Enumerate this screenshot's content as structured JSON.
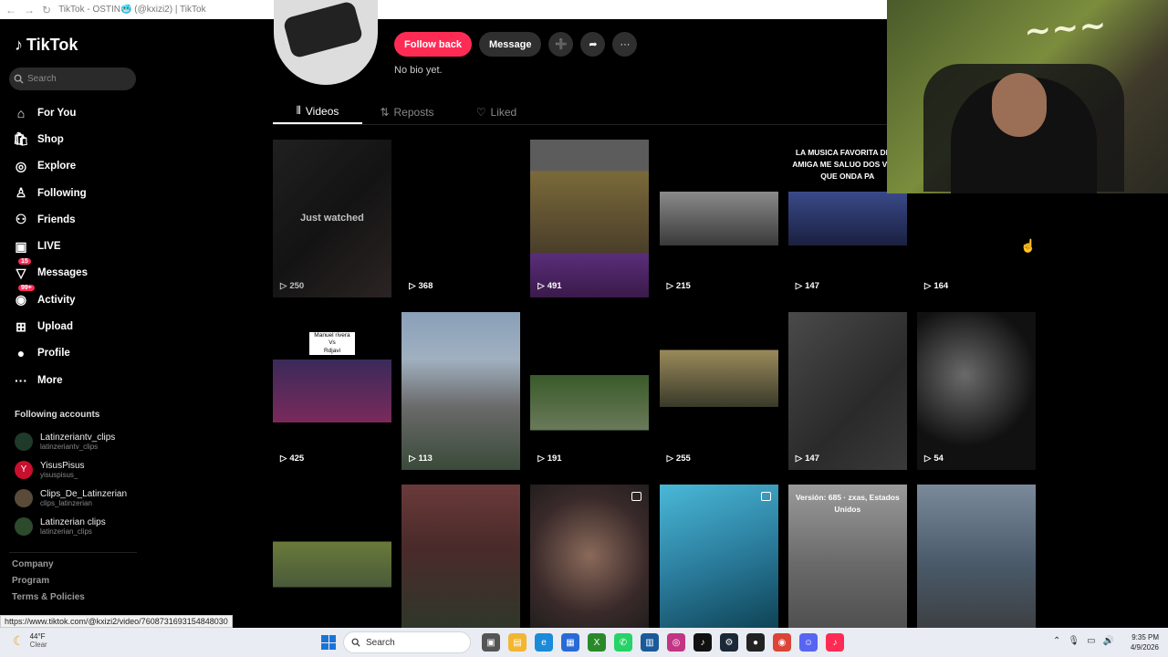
{
  "browser": {
    "title": "TikTok - OSTIN🥶 (@kxizi2) | TikTok",
    "back_glyph": "←",
    "fwd_glyph": "→",
    "reload_glyph": "↻"
  },
  "sidebar": {
    "logo": "TikTok",
    "search_placeholder": "Search",
    "nav": [
      {
        "label": "For You",
        "icon": "home-icon",
        "glyph": "⌂"
      },
      {
        "label": "Shop",
        "icon": "shop-icon",
        "glyph": "🛍"
      },
      {
        "label": "Explore",
        "icon": "compass-icon",
        "glyph": "◎"
      },
      {
        "label": "Following",
        "icon": "following-icon",
        "glyph": "♙"
      },
      {
        "label": "Friends",
        "icon": "friends-icon",
        "glyph": "⚇"
      },
      {
        "label": "LIVE",
        "icon": "live-icon",
        "glyph": "▣"
      },
      {
        "label": "Messages",
        "icon": "messages-icon",
        "glyph": "▽",
        "badge": "15"
      },
      {
        "label": "Activity",
        "icon": "activity-icon",
        "glyph": "◉",
        "badge": "99+"
      },
      {
        "label": "Upload",
        "icon": "upload-icon",
        "glyph": "⊞"
      },
      {
        "label": "Profile",
        "icon": "profile-icon",
        "glyph": "●"
      },
      {
        "label": "More",
        "icon": "more-icon",
        "glyph": "···"
      }
    ],
    "following_title": "Following accounts",
    "accounts": [
      {
        "name": "Latinzeriantv_clips",
        "handle": "latinzeriantv_clips",
        "avatar_bg": "#1f3a2a",
        "initial": ""
      },
      {
        "name": "YisusPisus",
        "handle": "yisuspisus_",
        "avatar_bg": "#c8102e",
        "initial": "Y"
      },
      {
        "name": "Clips_De_Latinzerian",
        "handle": "clips_latinzerian",
        "avatar_bg": "#5a4a3a",
        "initial": ""
      },
      {
        "name": "Latinzerian clips",
        "handle": "latinzerian_clips",
        "avatar_bg": "#2d4a2d",
        "initial": ""
      }
    ],
    "footer": [
      "Company",
      "Program",
      "Terms & Policies"
    ]
  },
  "profile": {
    "buttons": {
      "follow_back": "Follow back",
      "message": "Message",
      "add_friend_glyph": "➕",
      "share_glyph": "➦",
      "more_glyph": "···"
    },
    "bio": "No bio yet."
  },
  "tabs": [
    {
      "label": "Videos",
      "glyph": "⦀"
    },
    {
      "label": "Reposts",
      "glyph": "⇅"
    },
    {
      "label": "Liked",
      "glyph": "♡"
    }
  ],
  "videos": [
    {
      "views": "250",
      "bg": "linear-gradient(135deg,#2b2b2b,#1a1a1a 50%,#3a3030)",
      "just_watched": "Just watched",
      "faded": true
    },
    {
      "views": "368",
      "bg": "#000"
    },
    {
      "views": "491",
      "bg": "linear-gradient(180deg,#5c5c5c 0%,#5c5c5c 20%,#7a6a3a 20%,#4a3e2a 72%,#5a2e7a 72%,#3a1a4a 100%)"
    },
    {
      "views": "215",
      "bg": "linear-gradient(180deg,#000 0%,#000 33%,#8a8a8a 33%,#3a3a3a 67%,#000 67%)"
    },
    {
      "views": "147",
      "bg": "linear-gradient(180deg,#000 0%,#000 33%,#3a4a8a 33%,#1a2040 67%,#000 67%)",
      "overlay": "LA MUSICA FAVORITA DE M\nAMIGA ME SALUO DOS VESE\nQUE ONDA PA"
    },
    {
      "views": "164",
      "bg": "#000"
    },
    {
      "views": "425",
      "bg": "linear-gradient(180deg,#000 0%,#000 30%,#3a2a5a 30%,#7a2a5a 70%,#000 70%)",
      "label": "Manuel rivera\nVs\nRdjavi"
    },
    {
      "views": "113",
      "bg": "linear-gradient(180deg,#8aa0b8 0%,#a0b0c0 30%,#6a6a6a 60%,#3a4a3a 100%)"
    },
    {
      "views": "191",
      "bg": "linear-gradient(180deg,#000 0%,#000 40%,#3a5a2a 40%,#6a7a5a 75%,#000 75%)"
    },
    {
      "views": "255",
      "bg": "linear-gradient(180deg,#000 0%,#000 24%,#9a8a5a 24%,#3a3a2a 60%,#000 60%)"
    },
    {
      "views": "147",
      "bg": "linear-gradient(135deg,#4a4a4a,#2a2a2a 60%,#3a3a3a)"
    },
    {
      "views": "54",
      "bg": "radial-gradient(circle at 40% 40%,#6a6a6a,#111 60%)"
    },
    {
      "views": "",
      "bg": "linear-gradient(180deg,#000 0%,#000 36%,#6a7a3a 36%,#4a5a3a 65%,#000 65%)"
    },
    {
      "views": "",
      "bg": "linear-gradient(180deg,#6a3a3a,#4a2a2a 40%,#2a3a2a 100%)"
    },
    {
      "views": "",
      "bg": "radial-gradient(circle at 50% 45%,#8a6a5a,#3a2a2a 55%,#1a1a1a)",
      "gallery": true
    },
    {
      "views": "",
      "bg": "linear-gradient(160deg,#4ab8d8,#2a7a9a 50%,#0a3a4a)",
      "gallery": true
    },
    {
      "views": "",
      "bg": "linear-gradient(180deg,#9a9a9a,#6a6a6a 50%,#4a4a4a)",
      "overlay": "Versión: 685 · zxas, Estados Unidos"
    },
    {
      "views": "",
      "bg": "linear-gradient(180deg,#7a8a9a,#4a5a6a 50%,#3a3a3a)"
    }
  ],
  "status_url": "https://www.tiktok.com/@kxizi2/video/7608731693154848030",
  "taskbar": {
    "temp": "44°F",
    "weather": "Clear",
    "search": "Search",
    "time": "9:35 PM",
    "date": "4/9/2026",
    "apps": [
      {
        "name": "task-view-icon",
        "color": "#555",
        "glyph": "▣"
      },
      {
        "name": "file-explorer-icon",
        "color": "#f2b630",
        "glyph": "▤"
      },
      {
        "name": "edge-icon",
        "color": "#1b8ad8",
        "glyph": "e"
      },
      {
        "name": "store-icon",
        "color": "#2a6ad8",
        "glyph": "▦"
      },
      {
        "name": "xbox-icon",
        "color": "#2a8a2a",
        "glyph": "X"
      },
      {
        "name": "whatsapp-icon",
        "color": "#25d366",
        "glyph": "✆"
      },
      {
        "name": "photos-icon",
        "color": "#1a5a9a",
        "glyph": "▥"
      },
      {
        "name": "instagram-icon",
        "color": "#c13584",
        "glyph": "◎"
      },
      {
        "name": "tiktok-icon",
        "color": "#111",
        "glyph": "♪"
      },
      {
        "name": "steam-icon",
        "color": "#1b2838",
        "glyph": "⚙"
      },
      {
        "name": "obs-icon",
        "color": "#222",
        "glyph": "●"
      },
      {
        "name": "chrome-icon",
        "color": "#db4437",
        "glyph": "◉"
      },
      {
        "name": "discord-icon",
        "color": "#5865f2",
        "glyph": "☺"
      },
      {
        "name": "tiktok-live-icon",
        "color": "#fe2c55",
        "glyph": "♪"
      }
    ]
  }
}
